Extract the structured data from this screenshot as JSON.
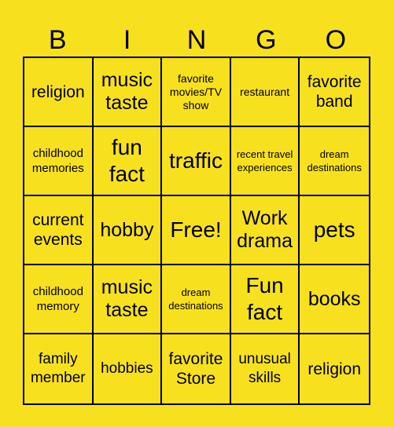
{
  "header": {
    "letters": [
      "B",
      "I",
      "N",
      "G",
      "O"
    ]
  },
  "colors": {
    "background": "#f7e11f",
    "grid_lines": "#000000",
    "text": "#000000"
  },
  "board": {
    "rows": [
      [
        "religion",
        "music taste",
        "favorite movies/TV show",
        "restaurant",
        "favorite band"
      ],
      [
        "childhood memories",
        "fun fact",
        "traffic",
        "recent travel experiences",
        "dream destinations"
      ],
      [
        "current events",
        "hobby",
        "Free!",
        "Work drama",
        "pets"
      ],
      [
        "childhood memory",
        "music taste",
        "dream destinations",
        "Fun fact",
        "books"
      ],
      [
        "family member",
        "hobbies",
        "favorite Store",
        "unusual skills",
        "religion"
      ]
    ],
    "free_space": "Free!"
  }
}
